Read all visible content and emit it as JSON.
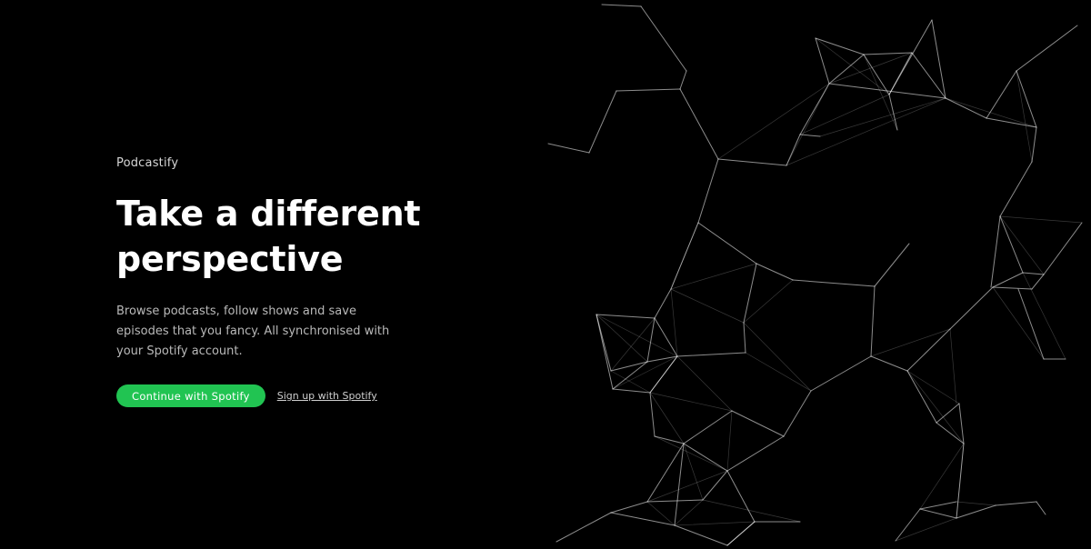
{
  "brand": {
    "name": "Podcastify"
  },
  "hero": {
    "headline_line1": "Take a different",
    "headline_line2": "perspective",
    "description": "Browse podcasts, follow shows and save episodes that you fancy. All synchronised with your Spotify account."
  },
  "actions": {
    "primary_label": "Continue with Spotify",
    "secondary_label": "Sign up with Spotify"
  },
  "colors": {
    "background": "#000000",
    "accent": "#21c452",
    "network_line": "#ffffff"
  }
}
